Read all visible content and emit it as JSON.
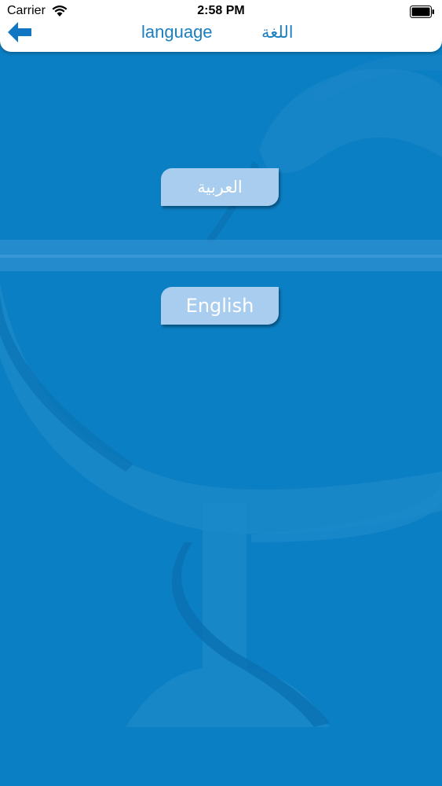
{
  "status_bar": {
    "carrier": "Carrier",
    "time": "2:58 PM"
  },
  "header": {
    "title_en": "language",
    "title_ar": "اللغة",
    "back_icon": "arrow-left-icon"
  },
  "languages": {
    "arabic_label": "العربية",
    "english_label": "English"
  },
  "colors": {
    "background": "#0b7fc3",
    "header_text": "#1b7fbf",
    "button_fill": "#a9cdee"
  }
}
